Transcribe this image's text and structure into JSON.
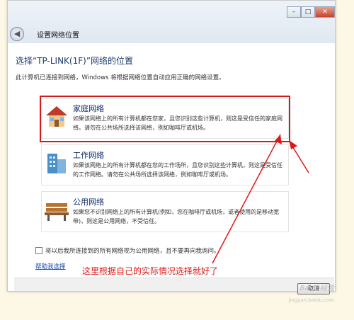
{
  "window": {
    "title": "设置网络位置",
    "controls": {
      "minimize": "–",
      "maximize": "□",
      "close": "✕"
    },
    "back_glyph": "◀"
  },
  "heading": "选择“TP-LINK(1F)”网络的位置",
  "description": "此计算机已连接到网络，Windows 将根据网络位置自动应用正确的网络设置。",
  "options": [
    {
      "icon": "house-icon",
      "title": "家庭网络",
      "desc": "如果该网络上的所有计算机都在您家，且您识别这些计算机，则这是受信任的家庭网络。请勿在公共场所选择该网络，例如咖啡厅或机场。",
      "selected": true
    },
    {
      "icon": "office-building-icon",
      "title": "工作网络",
      "desc": "如果该网络上的所有计算机都在您的工作场所，且您识别这些计算机，则这是受信任的工作网络。请勿在公共场所选择该网络，例如咖啡厅或机场。"
    },
    {
      "icon": "park-bench-icon",
      "title": "公用网络",
      "desc": "如果您不识别网络上的所有计算机(例如，您在咖啡厅或机场，或者使用的是移动宽带)，则这是公用网络，不受信任。"
    }
  ],
  "checkbox_label": "将以后我所连接到的所有网络视为公用网络，且不要再向我询问。",
  "help_link": "帮助我选择",
  "cancel_button": "取消",
  "annotation": "这里根据自己的实际情况选择就好了",
  "watermark": "Baidu经验",
  "watermark_sub": "jingyan.baidu.com",
  "accent": "#d21b1b"
}
